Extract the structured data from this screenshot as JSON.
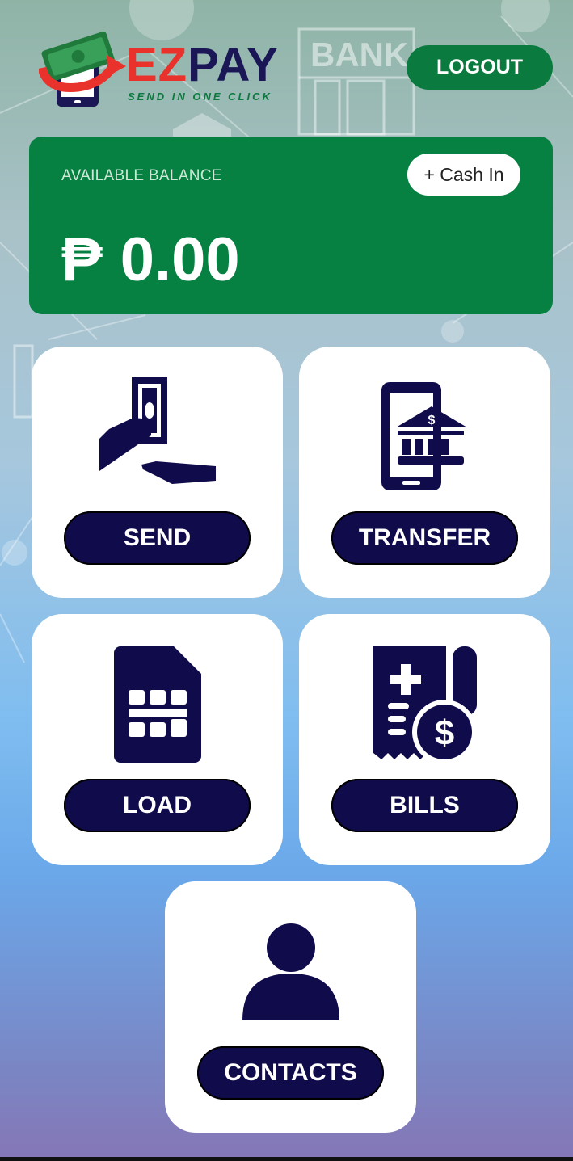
{
  "header": {
    "logo_ez": "EZ",
    "logo_pay": "PAY",
    "logo_tagline": "SEND IN ONE CLICK",
    "logout_label": "LOGOUT",
    "background_sign": "BANK"
  },
  "balance": {
    "label": "AVAILABLE BALANCE",
    "currency_symbol": "₱",
    "amount": "0.00",
    "cash_in_label": "+ Cash In"
  },
  "tiles": [
    {
      "id": "send",
      "label": "SEND",
      "icon": "money-hand-icon"
    },
    {
      "id": "transfer",
      "label": "TRANSFER",
      "icon": "mobile-bank-icon"
    },
    {
      "id": "load",
      "label": "LOAD",
      "icon": "sim-card-icon"
    },
    {
      "id": "bills",
      "label": "BILLS",
      "icon": "bill-receipt-icon"
    },
    {
      "id": "contacts",
      "label": "CONTACTS",
      "icon": "person-icon"
    }
  ],
  "colors": {
    "primary_green": "#078142",
    "navy": "#100b4a",
    "brand_red": "#e8322b"
  }
}
